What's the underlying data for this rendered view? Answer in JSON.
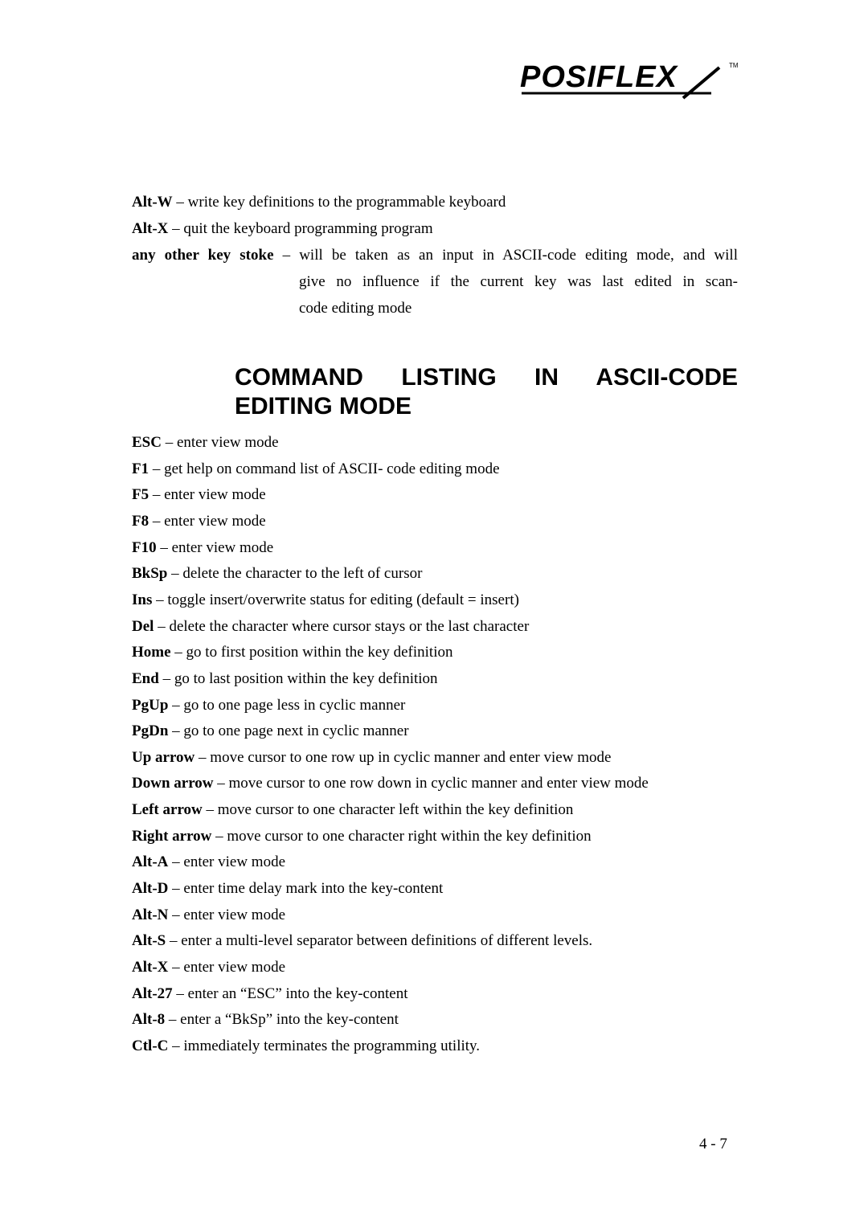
{
  "header": {
    "logo_text": "POSIFLEX",
    "trademark": "TM"
  },
  "intro_entries": [
    {
      "key": "Alt-W",
      "sep": " – ",
      "desc": "write key definitions to the programmable keyboard"
    },
    {
      "key": "Alt-X",
      "sep": " – ",
      "desc": "quit the keyboard programming program"
    }
  ],
  "other_key": {
    "key": "any other key stoke",
    "sep": " – ",
    "line1": "will be taken as an input in ASCII-code editing mode, and will",
    "line2": "give no influence if the current key was last edited in scan-",
    "line3": "code editing mode"
  },
  "section": {
    "heading_line1": "COMMAND LISTING IN ASCII-CODE",
    "heading_line2": "EDITING MODE"
  },
  "commands": [
    {
      "key": "ESC",
      "sep": " – ",
      "desc": "enter view mode"
    },
    {
      "key": "F1",
      "sep": " – ",
      "desc": "get help on command list of ASCII- code editing mode"
    },
    {
      "key": "F5",
      "sep": " – ",
      "desc": "enter view mode"
    },
    {
      "key": "F8",
      "sep": " – ",
      "desc": "enter view mode"
    },
    {
      "key": "F10",
      "sep": " – ",
      "desc": "enter view mode"
    },
    {
      "key": "BkSp",
      "sep": " – ",
      "desc": "delete the character to the left of cursor"
    },
    {
      "key": "Ins",
      "sep": " – ",
      "desc": "toggle insert/overwrite status for editing (default = insert)"
    },
    {
      "key": "Del",
      "sep": " – ",
      "desc": "delete the character where cursor stays or the last character"
    },
    {
      "key": "Home",
      "sep": " – ",
      "desc": "go to first position within the key definition"
    },
    {
      "key": "End",
      "sep": " – ",
      "desc": "go to last position within the key definition"
    },
    {
      "key": "PgUp",
      "sep": " – ",
      "desc": "go to one page less in cyclic manner"
    },
    {
      "key": "PgDn",
      "sep": " – ",
      "desc": "go to one page next in cyclic manner"
    },
    {
      "key": "Up arrow",
      "sep": " – ",
      "desc": "move cursor to one row up in cyclic manner and enter view mode"
    },
    {
      "key": "Down arrow",
      "sep": " – ",
      "desc": "move cursor to one row down in cyclic manner and enter view mode"
    },
    {
      "key": "Left arrow",
      "sep": " – ",
      "desc": "move cursor to one character left within the key definition"
    },
    {
      "key": "Right arrow",
      "sep": " – ",
      "desc": "move cursor to one character right within the key definition"
    },
    {
      "key": "Alt-A",
      "sep": " – ",
      "desc": "enter view mode"
    },
    {
      "key": "Alt-D",
      "sep": " – ",
      "desc": "enter time delay mark into the key-content"
    },
    {
      "key": "Alt-N",
      "sep": " – ",
      "desc": "enter view mode"
    },
    {
      "key": "Alt-S",
      "sep": " – ",
      "desc": "enter a multi-level separator between definitions of different levels."
    },
    {
      "key": "Alt-X",
      "sep": " – ",
      "desc": "enter view mode"
    },
    {
      "key": "Alt-27",
      "sep": " – ",
      "desc": "enter an “ESC” into the key-content"
    },
    {
      "key": "Alt-8",
      "sep": " – ",
      "desc": "enter a “BkSp” into the key-content"
    },
    {
      "key": "Ctl-C",
      "sep": " – ",
      "desc": "immediately terminates the programming utility."
    }
  ],
  "footer": {
    "page_number": "4 - 7"
  }
}
